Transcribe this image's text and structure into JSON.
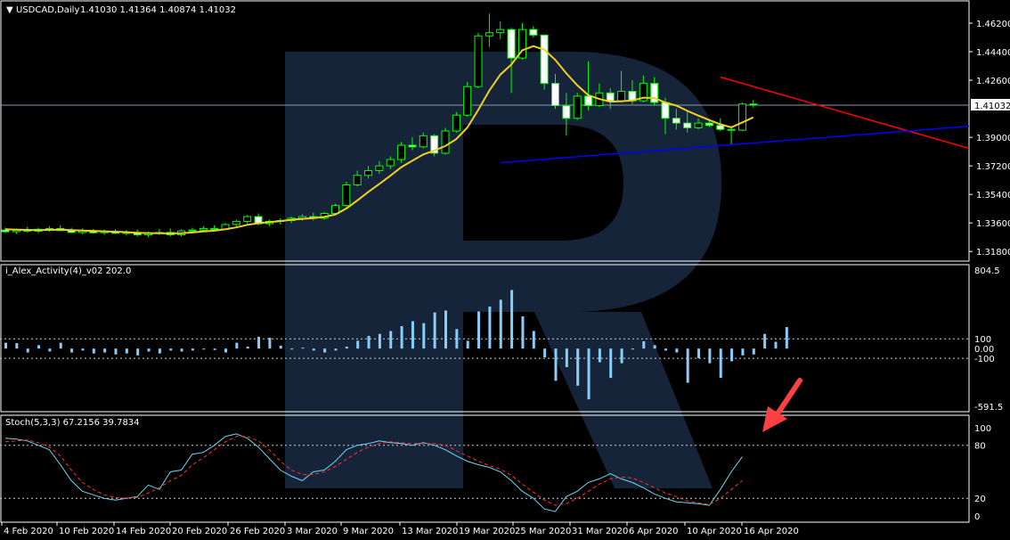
{
  "chart_data": [
    {
      "type": "candlestick",
      "symbol_label": "USDCAD,Daily",
      "ohlc_label": "1.41030 1.41364 1.40874 1.41032",
      "current_price_label": "1.41032",
      "ylim": [
        1.3125,
        1.4755
      ],
      "y_ticks": [
        "1.46200",
        "1.44400",
        "1.42600",
        "1.39000",
        "1.37200",
        "1.35400",
        "1.33600",
        "1.31800"
      ],
      "y_tick_values": [
        1.462,
        1.444,
        1.426,
        1.39,
        1.372,
        1.354,
        1.336,
        1.318
      ],
      "candles": [
        {
          "o": 1.3315,
          "h": 1.333,
          "l": 1.3295,
          "c": 1.3305
        },
        {
          "o": 1.3305,
          "h": 1.3325,
          "l": 1.329,
          "c": 1.3315
        },
        {
          "o": 1.3315,
          "h": 1.3335,
          "l": 1.33,
          "c": 1.3308
        },
        {
          "o": 1.3308,
          "h": 1.333,
          "l": 1.3295,
          "c": 1.332
        },
        {
          "o": 1.332,
          "h": 1.334,
          "l": 1.3305,
          "c": 1.3325
        },
        {
          "o": 1.3325,
          "h": 1.3345,
          "l": 1.331,
          "c": 1.3312
        },
        {
          "o": 1.3312,
          "h": 1.333,
          "l": 1.3295,
          "c": 1.33
        },
        {
          "o": 1.33,
          "h": 1.3325,
          "l": 1.329,
          "c": 1.331
        },
        {
          "o": 1.331,
          "h": 1.3322,
          "l": 1.3292,
          "c": 1.3298
        },
        {
          "o": 1.3298,
          "h": 1.3318,
          "l": 1.3285,
          "c": 1.3305
        },
        {
          "o": 1.3305,
          "h": 1.332,
          "l": 1.329,
          "c": 1.3295
        },
        {
          "o": 1.3295,
          "h": 1.3315,
          "l": 1.328,
          "c": 1.33
        },
        {
          "o": 1.33,
          "h": 1.3318,
          "l": 1.3275,
          "c": 1.3285
        },
        {
          "o": 1.3285,
          "h": 1.3305,
          "l": 1.327,
          "c": 1.3295
        },
        {
          "o": 1.3295,
          "h": 1.3322,
          "l": 1.3285,
          "c": 1.33
        },
        {
          "o": 1.33,
          "h": 1.3325,
          "l": 1.3275,
          "c": 1.3285
        },
        {
          "o": 1.3285,
          "h": 1.332,
          "l": 1.3275,
          "c": 1.331
        },
        {
          "o": 1.331,
          "h": 1.333,
          "l": 1.3295,
          "c": 1.3315
        },
        {
          "o": 1.3315,
          "h": 1.334,
          "l": 1.3305,
          "c": 1.3325
        },
        {
          "o": 1.3325,
          "h": 1.3345,
          "l": 1.331,
          "c": 1.332
        },
        {
          "o": 1.332,
          "h": 1.336,
          "l": 1.3315,
          "c": 1.335
        },
        {
          "o": 1.335,
          "h": 1.338,
          "l": 1.334,
          "c": 1.337
        },
        {
          "o": 1.337,
          "h": 1.341,
          "l": 1.3355,
          "c": 1.34
        },
        {
          "o": 1.34,
          "h": 1.342,
          "l": 1.3345,
          "c": 1.3355
        },
        {
          "o": 1.3355,
          "h": 1.338,
          "l": 1.334,
          "c": 1.337
        },
        {
          "o": 1.337,
          "h": 1.339,
          "l": 1.335,
          "c": 1.3375
        },
        {
          "o": 1.3375,
          "h": 1.34,
          "l": 1.336,
          "c": 1.339
        },
        {
          "o": 1.339,
          "h": 1.3415,
          "l": 1.3375,
          "c": 1.34
        },
        {
          "o": 1.34,
          "h": 1.3425,
          "l": 1.3375,
          "c": 1.339
        },
        {
          "o": 1.339,
          "h": 1.343,
          "l": 1.338,
          "c": 1.342
        },
        {
          "o": 1.342,
          "h": 1.348,
          "l": 1.341,
          "c": 1.347
        },
        {
          "o": 1.347,
          "h": 1.362,
          "l": 1.346,
          "c": 1.36
        },
        {
          "o": 1.36,
          "h": 1.369,
          "l": 1.359,
          "c": 1.366
        },
        {
          "o": 1.366,
          "h": 1.372,
          "l": 1.364,
          "c": 1.369
        },
        {
          "o": 1.369,
          "h": 1.375,
          "l": 1.367,
          "c": 1.372
        },
        {
          "o": 1.372,
          "h": 1.378,
          "l": 1.37,
          "c": 1.376
        },
        {
          "o": 1.376,
          "h": 1.387,
          "l": 1.374,
          "c": 1.385
        },
        {
          "o": 1.385,
          "h": 1.39,
          "l": 1.382,
          "c": 1.384
        },
        {
          "o": 1.384,
          "h": 1.393,
          "l": 1.383,
          "c": 1.391
        },
        {
          "o": 1.391,
          "h": 1.392,
          "l": 1.378,
          "c": 1.38
        },
        {
          "o": 1.38,
          "h": 1.396,
          "l": 1.379,
          "c": 1.394
        },
        {
          "o": 1.394,
          "h": 1.406,
          "l": 1.393,
          "c": 1.404
        },
        {
          "o": 1.404,
          "h": 1.425,
          "l": 1.403,
          "c": 1.422
        },
        {
          "o": 1.422,
          "h": 1.456,
          "l": 1.421,
          "c": 1.454
        },
        {
          "o": 1.454,
          "h": 1.468,
          "l": 1.447,
          "c": 1.456
        },
        {
          "o": 1.456,
          "h": 1.463,
          "l": 1.452,
          "c": 1.458
        },
        {
          "o": 1.458,
          "h": 1.459,
          "l": 1.418,
          "c": 1.44
        },
        {
          "o": 1.44,
          "h": 1.462,
          "l": 1.439,
          "c": 1.458
        },
        {
          "o": 1.458,
          "h": 1.46,
          "l": 1.453,
          "c": 1.4545
        },
        {
          "o": 1.4545,
          "h": 1.455,
          "l": 1.42,
          "c": 1.424
        },
        {
          "o": 1.424,
          "h": 1.43,
          "l": 1.408,
          "c": 1.41
        },
        {
          "o": 1.41,
          "h": 1.418,
          "l": 1.391,
          "c": 1.402
        },
        {
          "o": 1.402,
          "h": 1.418,
          "l": 1.401,
          "c": 1.416
        },
        {
          "o": 1.416,
          "h": 1.438,
          "l": 1.407,
          "c": 1.41
        },
        {
          "o": 1.41,
          "h": 1.424,
          "l": 1.409,
          "c": 1.418
        },
        {
          "o": 1.418,
          "h": 1.421,
          "l": 1.408,
          "c": 1.413
        },
        {
          "o": 1.413,
          "h": 1.432,
          "l": 1.412,
          "c": 1.419
        },
        {
          "o": 1.419,
          "h": 1.426,
          "l": 1.411,
          "c": 1.413
        },
        {
          "o": 1.413,
          "h": 1.429,
          "l": 1.412,
          "c": 1.424
        },
        {
          "o": 1.424,
          "h": 1.428,
          "l": 1.41,
          "c": 1.412
        },
        {
          "o": 1.412,
          "h": 1.415,
          "l": 1.392,
          "c": 1.402
        },
        {
          "o": 1.402,
          "h": 1.408,
          "l": 1.395,
          "c": 1.399
        },
        {
          "o": 1.399,
          "h": 1.406,
          "l": 1.393,
          "c": 1.396
        },
        {
          "o": 1.396,
          "h": 1.402,
          "l": 1.395,
          "c": 1.399
        },
        {
          "o": 1.399,
          "h": 1.4005,
          "l": 1.3965,
          "c": 1.3975
        },
        {
          "o": 1.3975,
          "h": 1.402,
          "l": 1.394,
          "c": 1.395
        },
        {
          "o": 1.395,
          "h": 1.397,
          "l": 1.385,
          "c": 1.3945
        },
        {
          "o": 1.3945,
          "h": 1.412,
          "l": 1.394,
          "c": 1.411
        },
        {
          "o": 1.411,
          "h": 1.4136,
          "l": 1.4087,
          "c": 1.4103
        }
      ],
      "ma_values": [
        1.332,
        1.3318,
        1.3316,
        1.3315,
        1.3316,
        1.3317,
        1.3315,
        1.3312,
        1.331,
        1.3307,
        1.3305,
        1.3302,
        1.3298,
        1.3296,
        1.3295,
        1.3294,
        1.3295,
        1.33,
        1.3306,
        1.3311,
        1.332,
        1.3332,
        1.3348,
        1.3358,
        1.3365,
        1.3372,
        1.338,
        1.3386,
        1.3391,
        1.3398,
        1.3413,
        1.3451,
        1.3502,
        1.3556,
        1.3606,
        1.3658,
        1.3712,
        1.3752,
        1.3792,
        1.3817,
        1.3845,
        1.3889,
        1.3962,
        1.4073,
        1.4195,
        1.4296,
        1.4359,
        1.4449,
        1.4475,
        1.4453,
        1.4388,
        1.4303,
        1.4228,
        1.4166,
        1.4142,
        1.4125,
        1.4128,
        1.4132,
        1.415,
        1.4148,
        1.412,
        1.41,
        1.4067,
        1.4037,
        1.4009,
        1.3982,
        1.3963,
        1.3994,
        1.4026
      ],
      "trendlines": [
        {
          "color": "#ff0000",
          "x1": 65,
          "y1": 1.428,
          "x2": 95,
          "y2": 1.383
        },
        {
          "color": "#0000ff",
          "x1": 45,
          "y1": 1.374,
          "x2": 95,
          "y2": 1.397
        }
      ]
    },
    {
      "type": "bar",
      "indicator_label": "i_Alex_Activity(4)_v02 202.0",
      "ylim": [
        -591.5,
        804.5
      ],
      "y_ticks": [
        "804.5",
        "100",
        "0.00",
        "-100",
        "-591.5"
      ],
      "y_tick_values": [
        804.5,
        100,
        0,
        -100,
        -591.5
      ],
      "levels": [
        100,
        -100
      ],
      "values": [
        60,
        55,
        -40,
        35,
        -30,
        60,
        -40,
        -20,
        -50,
        -40,
        -60,
        -50,
        -70,
        -30,
        -50,
        -20,
        -30,
        -20,
        -10,
        -15,
        -40,
        60,
        20,
        120,
        110,
        30,
        -10,
        10,
        -20,
        -40,
        -20,
        20,
        80,
        130,
        150,
        180,
        230,
        280,
        260,
        370,
        390,
        200,
        80,
        380,
        430,
        500,
        600,
        330,
        180,
        -90,
        -330,
        -190,
        -380,
        -520,
        -140,
        -300,
        -150,
        -10,
        75,
        35,
        -20,
        -40,
        -350,
        -100,
        -150,
        -300,
        -130,
        -70,
        -60,
        150,
        70,
        220
      ]
    },
    {
      "type": "line",
      "indicator_label": "Stoch(5,3,3) 67.2156 39.7834",
      "ylim": [
        -5,
        110
      ],
      "y_ticks": [
        "100",
        "80",
        "20",
        "0"
      ],
      "y_tick_values": [
        100,
        80,
        20,
        0
      ],
      "levels": [
        80,
        20
      ],
      "series": [
        {
          "color": "#6fd7f2",
          "dash": false,
          "values": [
            88,
            87,
            85,
            80,
            75,
            58,
            40,
            28,
            24,
            20,
            18,
            20,
            22,
            35,
            30,
            50,
            52,
            70,
            72,
            80,
            90,
            93,
            88,
            78,
            65,
            52,
            45,
            40,
            50,
            52,
            62,
            75,
            80,
            82,
            85,
            83,
            82,
            80,
            83,
            80,
            75,
            68,
            62,
            58,
            55,
            50,
            40,
            28,
            20,
            8,
            5,
            22,
            28,
            38,
            42,
            48,
            42,
            38,
            32,
            25,
            20,
            16,
            15,
            14,
            12,
            30,
            50,
            67
          ],
          "x_offset": 0
        },
        {
          "color": "#ff3030",
          "dash": true,
          "values": [
            84,
            85,
            86,
            83,
            78,
            68,
            52,
            38,
            30,
            24,
            21,
            20,
            21,
            26,
            32,
            40,
            46,
            58,
            66,
            75,
            84,
            90,
            90,
            85,
            75,
            62,
            52,
            47,
            47,
            50,
            56,
            64,
            72,
            78,
            82,
            84,
            83,
            82,
            82,
            82,
            80,
            74,
            68,
            62,
            57,
            53,
            46,
            36,
            27,
            18,
            12,
            14,
            20,
            28,
            36,
            42,
            44,
            43,
            38,
            32,
            26,
            22,
            17,
            15,
            13,
            20,
            30,
            40
          ],
          "x_offset": 0
        }
      ]
    }
  ],
  "x_labels": [
    "4 Feb 2020",
    "10 Feb 2020",
    "14 Feb 2020",
    "20 Feb 2020",
    "26 Feb 2020",
    "3 Mar 2020",
    "9 Mar 2020",
    "13 Mar 2020",
    "19 Mar 2020",
    "25 Mar 2020",
    "31 Mar 2020",
    "6 Apr 2020",
    "10 Apr 2020",
    "16 Apr 2020"
  ],
  "colors": {
    "background": "#000000",
    "bull_fill": "#000000",
    "bull_stroke": "#00ff00",
    "bear_fill": "#ffffff",
    "bear_stroke": "#00ff00",
    "ma": "#f0d020",
    "activity_bars": "#87cefa",
    "grid_text": "#ffffff",
    "pane_border": "#ffffff",
    "arrow": "#ff4040",
    "watermark": "#1a2a44"
  }
}
